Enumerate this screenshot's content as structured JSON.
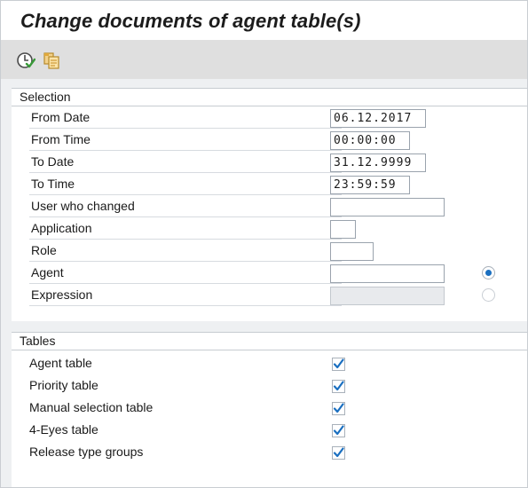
{
  "title": "Change documents of agent table(s)",
  "toolbar": {
    "execute_icon": "execute-clock-icon",
    "copy_icon": "copy-documents-icon"
  },
  "selection": {
    "header": "Selection",
    "fields": [
      {
        "label": "From Date",
        "value": "06.12.2017"
      },
      {
        "label": "From Time",
        "value": "00:00:00"
      },
      {
        "label": "To Date",
        "value": "31.12.9999"
      },
      {
        "label": "To Time",
        "value": "23:59:59"
      },
      {
        "label": "User who changed",
        "value": ""
      },
      {
        "label": "Application",
        "value": ""
      },
      {
        "label": "Role",
        "value": ""
      },
      {
        "label": "Agent",
        "value": "",
        "radio_selected": true
      },
      {
        "label": "Expression",
        "value": "",
        "radio_selected": false
      }
    ]
  },
  "tables": {
    "header": "Tables",
    "items": [
      {
        "label": "Agent table",
        "checked": true
      },
      {
        "label": "Priority table",
        "checked": true
      },
      {
        "label": "Manual selection table",
        "checked": true
      },
      {
        "label": "4-Eyes table",
        "checked": true
      },
      {
        "label": "Release type groups",
        "checked": true
      }
    ]
  },
  "colors": {
    "accent": "#1a6fc0",
    "check": "#1a6fc0",
    "toolbar_bg": "#dfdfdf",
    "content_bg": "#eef0f2"
  }
}
